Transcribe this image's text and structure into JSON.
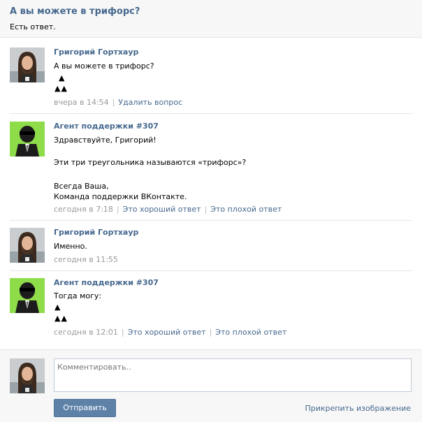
{
  "question": {
    "title": "А вы можете в трифорс?",
    "subtitle": "Есть ответ."
  },
  "messages": [
    {
      "author": "Григорий Гортхаур",
      "avatar": "user-avatar",
      "lines": [
        "А вы можете в трифорс?"
      ],
      "triforce_top": "▲",
      "triforce_bottom": "▲▲",
      "time": "вчера в 14:54",
      "actions": [
        "Удалить вопрос"
      ]
    },
    {
      "author": "Агент поддержки #307",
      "avatar": "support-agent-avatar",
      "lines": [
        "Здравствуйте, Григорий!",
        "Эти три треугольника называются «трифорс»?",
        "Всегда Ваша,",
        "Команда поддержки ВКонтакте."
      ],
      "time": "сегодня в 7:18",
      "actions": [
        "Это хороший ответ",
        "Это плохой ответ"
      ]
    },
    {
      "author": "Григорий Гортхаур",
      "avatar": "user-avatar",
      "lines": [
        "Именно."
      ],
      "time": "сегодня в 11:55",
      "actions": []
    },
    {
      "author": "Агент поддержки #307",
      "avatar": "support-agent-avatar",
      "lines": [
        "Тогда могу:"
      ],
      "triforce_top": "▲",
      "triforce_bottom": "▲▲",
      "time": "сегодня в 12:01",
      "actions": [
        "Это хороший ответ",
        "Это плохой ответ"
      ]
    }
  ],
  "comment": {
    "placeholder": "Комментировать..",
    "send_label": "Отправить",
    "attach_label": "Прикрепить изображение"
  },
  "colors": {
    "link": "#45688e",
    "meta": "#999999",
    "button": "#5e81a8",
    "agent_bg": "#8fdc4a"
  }
}
